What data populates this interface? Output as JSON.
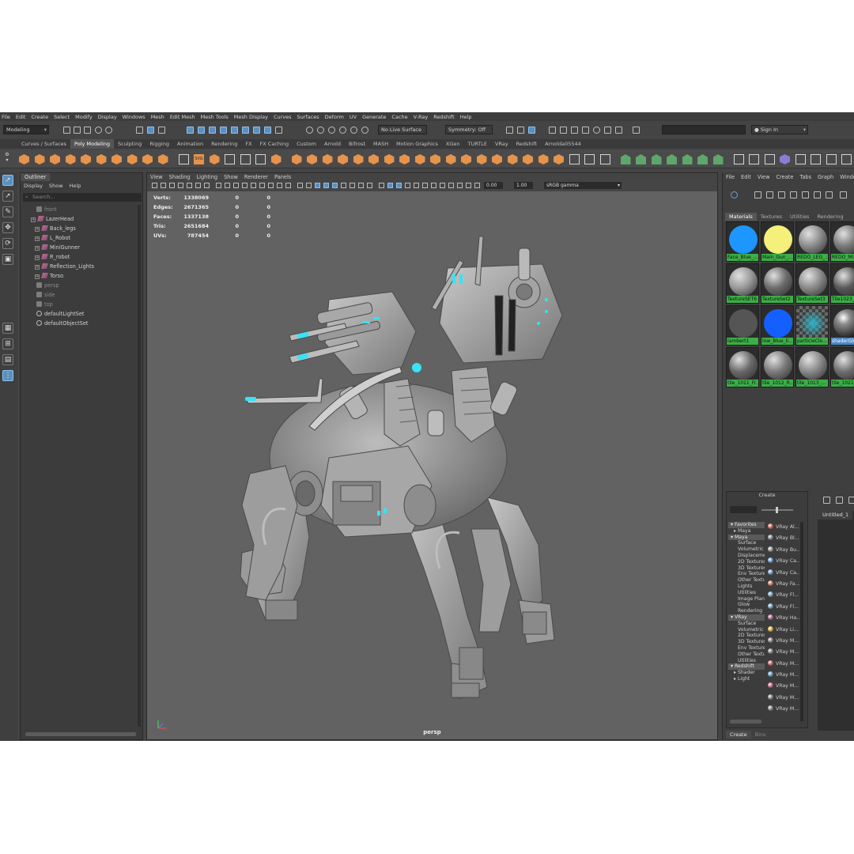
{
  "menubar": [
    "File",
    "Edit",
    "Create",
    "Select",
    "Modify",
    "Display",
    "Windows",
    "Mesh",
    "Edit Mesh",
    "Mesh Tools",
    "Mesh Display",
    "Curves",
    "Surfaces",
    "Deform",
    "UV",
    "Generate",
    "Cache",
    "V-Ray",
    "Redshift",
    "Help"
  ],
  "statusline": {
    "menuset": "Modeling",
    "live_surface": "No Live Surface",
    "symmetry": "Symmetry: Off",
    "sign_in": "Sign In"
  },
  "shelf_tabs": [
    "Curves / Surfaces",
    "Poly Modeling",
    "Sculpting",
    "Rigging",
    "Animation",
    "Rendering",
    "FX",
    "FX Caching",
    "Custom",
    "Arnold",
    "Bifrost",
    "MASH",
    "Motion Graphics",
    "XGen",
    "TURTLE",
    "VRay",
    "Redshift",
    "Arnolda05544"
  ],
  "shelf_active_tab": "Poly Modeling",
  "shelf_svg_label": "SVG",
  "outliner": {
    "title": "Outliner",
    "menu": [
      "Display",
      "Show",
      "Help"
    ],
    "search_placeholder": "Search...",
    "items": [
      {
        "label": "front",
        "kind": "camera",
        "dim": true
      },
      {
        "label": "LazerHead",
        "kind": "mesh",
        "dim": false
      },
      {
        "label": "Back_legs",
        "kind": "mesh",
        "dim": false
      },
      {
        "label": "L_Robot",
        "kind": "mesh",
        "dim": false
      },
      {
        "label": "MiniGunner",
        "kind": "mesh",
        "dim": false
      },
      {
        "label": "R_robot",
        "kind": "mesh",
        "dim": false
      },
      {
        "label": "Reflection_Lights",
        "kind": "mesh",
        "dim": false
      },
      {
        "label": "Torso",
        "kind": "mesh",
        "dim": false
      },
      {
        "label": "persp",
        "kind": "camera",
        "dim": true
      },
      {
        "label": "side",
        "kind": "camera",
        "dim": true
      },
      {
        "label": "top",
        "kind": "camera",
        "dim": true
      },
      {
        "label": "defaultLightSet",
        "kind": "set",
        "dim": false
      },
      {
        "label": "defaultObjectSet",
        "kind": "set",
        "dim": false
      }
    ]
  },
  "viewport": {
    "menu": [
      "View",
      "Shading",
      "Lighting",
      "Show",
      "Renderer",
      "Panels"
    ],
    "exposure": "0.00",
    "gamma": "1.00",
    "color_space": "sRGB gamma",
    "camera": "persp",
    "hud": [
      {
        "label": "Verts:",
        "v1": "1338069",
        "v2": "0",
        "v3": "0"
      },
      {
        "label": "Edges:",
        "v1": "2671365",
        "v2": "0",
        "v3": "0"
      },
      {
        "label": "Faces:",
        "v1": "1337138",
        "v2": "0",
        "v3": "0"
      },
      {
        "label": "Tris:",
        "v1": "2651684",
        "v2": "0",
        "v3": "0"
      },
      {
        "label": "UVs:",
        "v1": "787454",
        "v2": "0",
        "v3": "0"
      }
    ]
  },
  "hypershade": {
    "menu": [
      "File",
      "Edit",
      "View",
      "Create",
      "Tabs",
      "Graph",
      "Window"
    ],
    "tabs": [
      "Materials",
      "Textures",
      "Utilities",
      "Rendering"
    ],
    "swatches": [
      {
        "label": "Face_Blue_...",
        "color": "#1e96ff",
        "style": "solid",
        "selected": false
      },
      {
        "label": "Main_Gun_...",
        "color": "#f4f07a",
        "style": "solid",
        "selected": false
      },
      {
        "label": "REDO_LEG_...",
        "color": "#8d8d8d",
        "style": "rock",
        "selected": false
      },
      {
        "label": "REDO_MI...",
        "color": "#7a7a7a",
        "style": "rock",
        "selected": false
      },
      {
        "label": "TextureSET6",
        "color": "#9a9a9a",
        "style": "rock",
        "selected": false
      },
      {
        "label": "TextureSet2",
        "color": "#6d6d6d",
        "style": "rock",
        "selected": false
      },
      {
        "label": "TextureSet3",
        "color": "#8a8a8a",
        "style": "rock",
        "selected": false
      },
      {
        "label": "Tile1023_D...",
        "color": "#595959",
        "style": "rock",
        "selected": false
      },
      {
        "label": "lambert1",
        "color": "#555555",
        "style": "solid",
        "selected": false
      },
      {
        "label": "low_Blue_li...",
        "color": "#1460ff",
        "style": "solid",
        "selected": false
      },
      {
        "label": "particleClo...",
        "color": "#2fb4c8",
        "style": "checker",
        "selected": false
      },
      {
        "label": "shaderGlo...",
        "color": "#9a9a9a",
        "style": "glossy",
        "selected": true
      },
      {
        "label": "tile_1011_Fr...",
        "color": "#6a6a6a",
        "style": "rock",
        "selected": false
      },
      {
        "label": "tile_1012_R...",
        "color": "#7c7c7c",
        "style": "rock",
        "selected": false
      },
      {
        "label": "tile_1013_...",
        "color": "#8a8a8a",
        "style": "rock",
        "selected": false
      },
      {
        "label": "tile_1021_B...",
        "color": "#6e6e6e",
        "style": "rock",
        "selected": false
      }
    ],
    "create_title": "Create",
    "categories": [
      {
        "label": "Favorites",
        "type": "head"
      },
      {
        "label": "Maya",
        "type": "sub"
      },
      {
        "label": "Maya",
        "type": "head"
      },
      {
        "label": "Surface",
        "type": "item"
      },
      {
        "label": "Volumetric",
        "type": "item"
      },
      {
        "label": "Displacement",
        "type": "item"
      },
      {
        "label": "2D Textures",
        "type": "item"
      },
      {
        "label": "3D Textures",
        "type": "item"
      },
      {
        "label": "Env Textures",
        "type": "item"
      },
      {
        "label": "Other Textures",
        "type": "item"
      },
      {
        "label": "Lights",
        "type": "item"
      },
      {
        "label": "Utilities",
        "type": "item"
      },
      {
        "label": "Image Planes",
        "type": "item"
      },
      {
        "label": "Glow",
        "type": "item"
      },
      {
        "label": "Rendering",
        "type": "item"
      },
      {
        "label": "VRay",
        "type": "head"
      },
      {
        "label": "Surface",
        "type": "item"
      },
      {
        "label": "Volumetric",
        "type": "item"
      },
      {
        "label": "2D Textures",
        "type": "item"
      },
      {
        "label": "3D Textures",
        "type": "item"
      },
      {
        "label": "Env Textures",
        "type": "item"
      },
      {
        "label": "Other Textures",
        "type": "item"
      },
      {
        "label": "Utilities",
        "type": "item"
      },
      {
        "label": "Redshift",
        "type": "head"
      },
      {
        "label": "Shader",
        "type": "sub"
      },
      {
        "label": "Light",
        "type": "sub"
      }
    ],
    "nodes": [
      {
        "label": "VRay Al...",
        "color": "#d06a5a"
      },
      {
        "label": "VRay Bl...",
        "color": "#8a8a8a"
      },
      {
        "label": "VRay Bu...",
        "color": "#9a9a9a"
      },
      {
        "label": "VRay Ca...",
        "color": "#6f9ec8"
      },
      {
        "label": "VRay Ca...",
        "color": "#6f9ec8"
      },
      {
        "label": "VRay Fa...",
        "color": "#d07a5a"
      },
      {
        "label": "VRay Fl...",
        "color": "#7aa0c0"
      },
      {
        "label": "VRay Fl...",
        "color": "#7aa0c0"
      },
      {
        "label": "VRay Ha...",
        "color": "#b06a9a"
      },
      {
        "label": "VRay Li...",
        "color": "#e0b040"
      },
      {
        "label": "VRay M...",
        "color": "#8a8a8a"
      },
      {
        "label": "VRay M...",
        "color": "#8a8a8a"
      },
      {
        "label": "VRay M...",
        "color": "#c86a6a"
      },
      {
        "label": "VRay M...",
        "color": "#6a9ac8"
      },
      {
        "label": "VRay M...",
        "color": "#c86a8a"
      },
      {
        "label": "VRay M...",
        "color": "#8a8a8a"
      },
      {
        "label": "VRay M...",
        "color": "#8a8a8a"
      }
    ],
    "untitled_tab": "Untitled_1",
    "bottom_tabs": [
      "Create",
      "Bins"
    ]
  }
}
